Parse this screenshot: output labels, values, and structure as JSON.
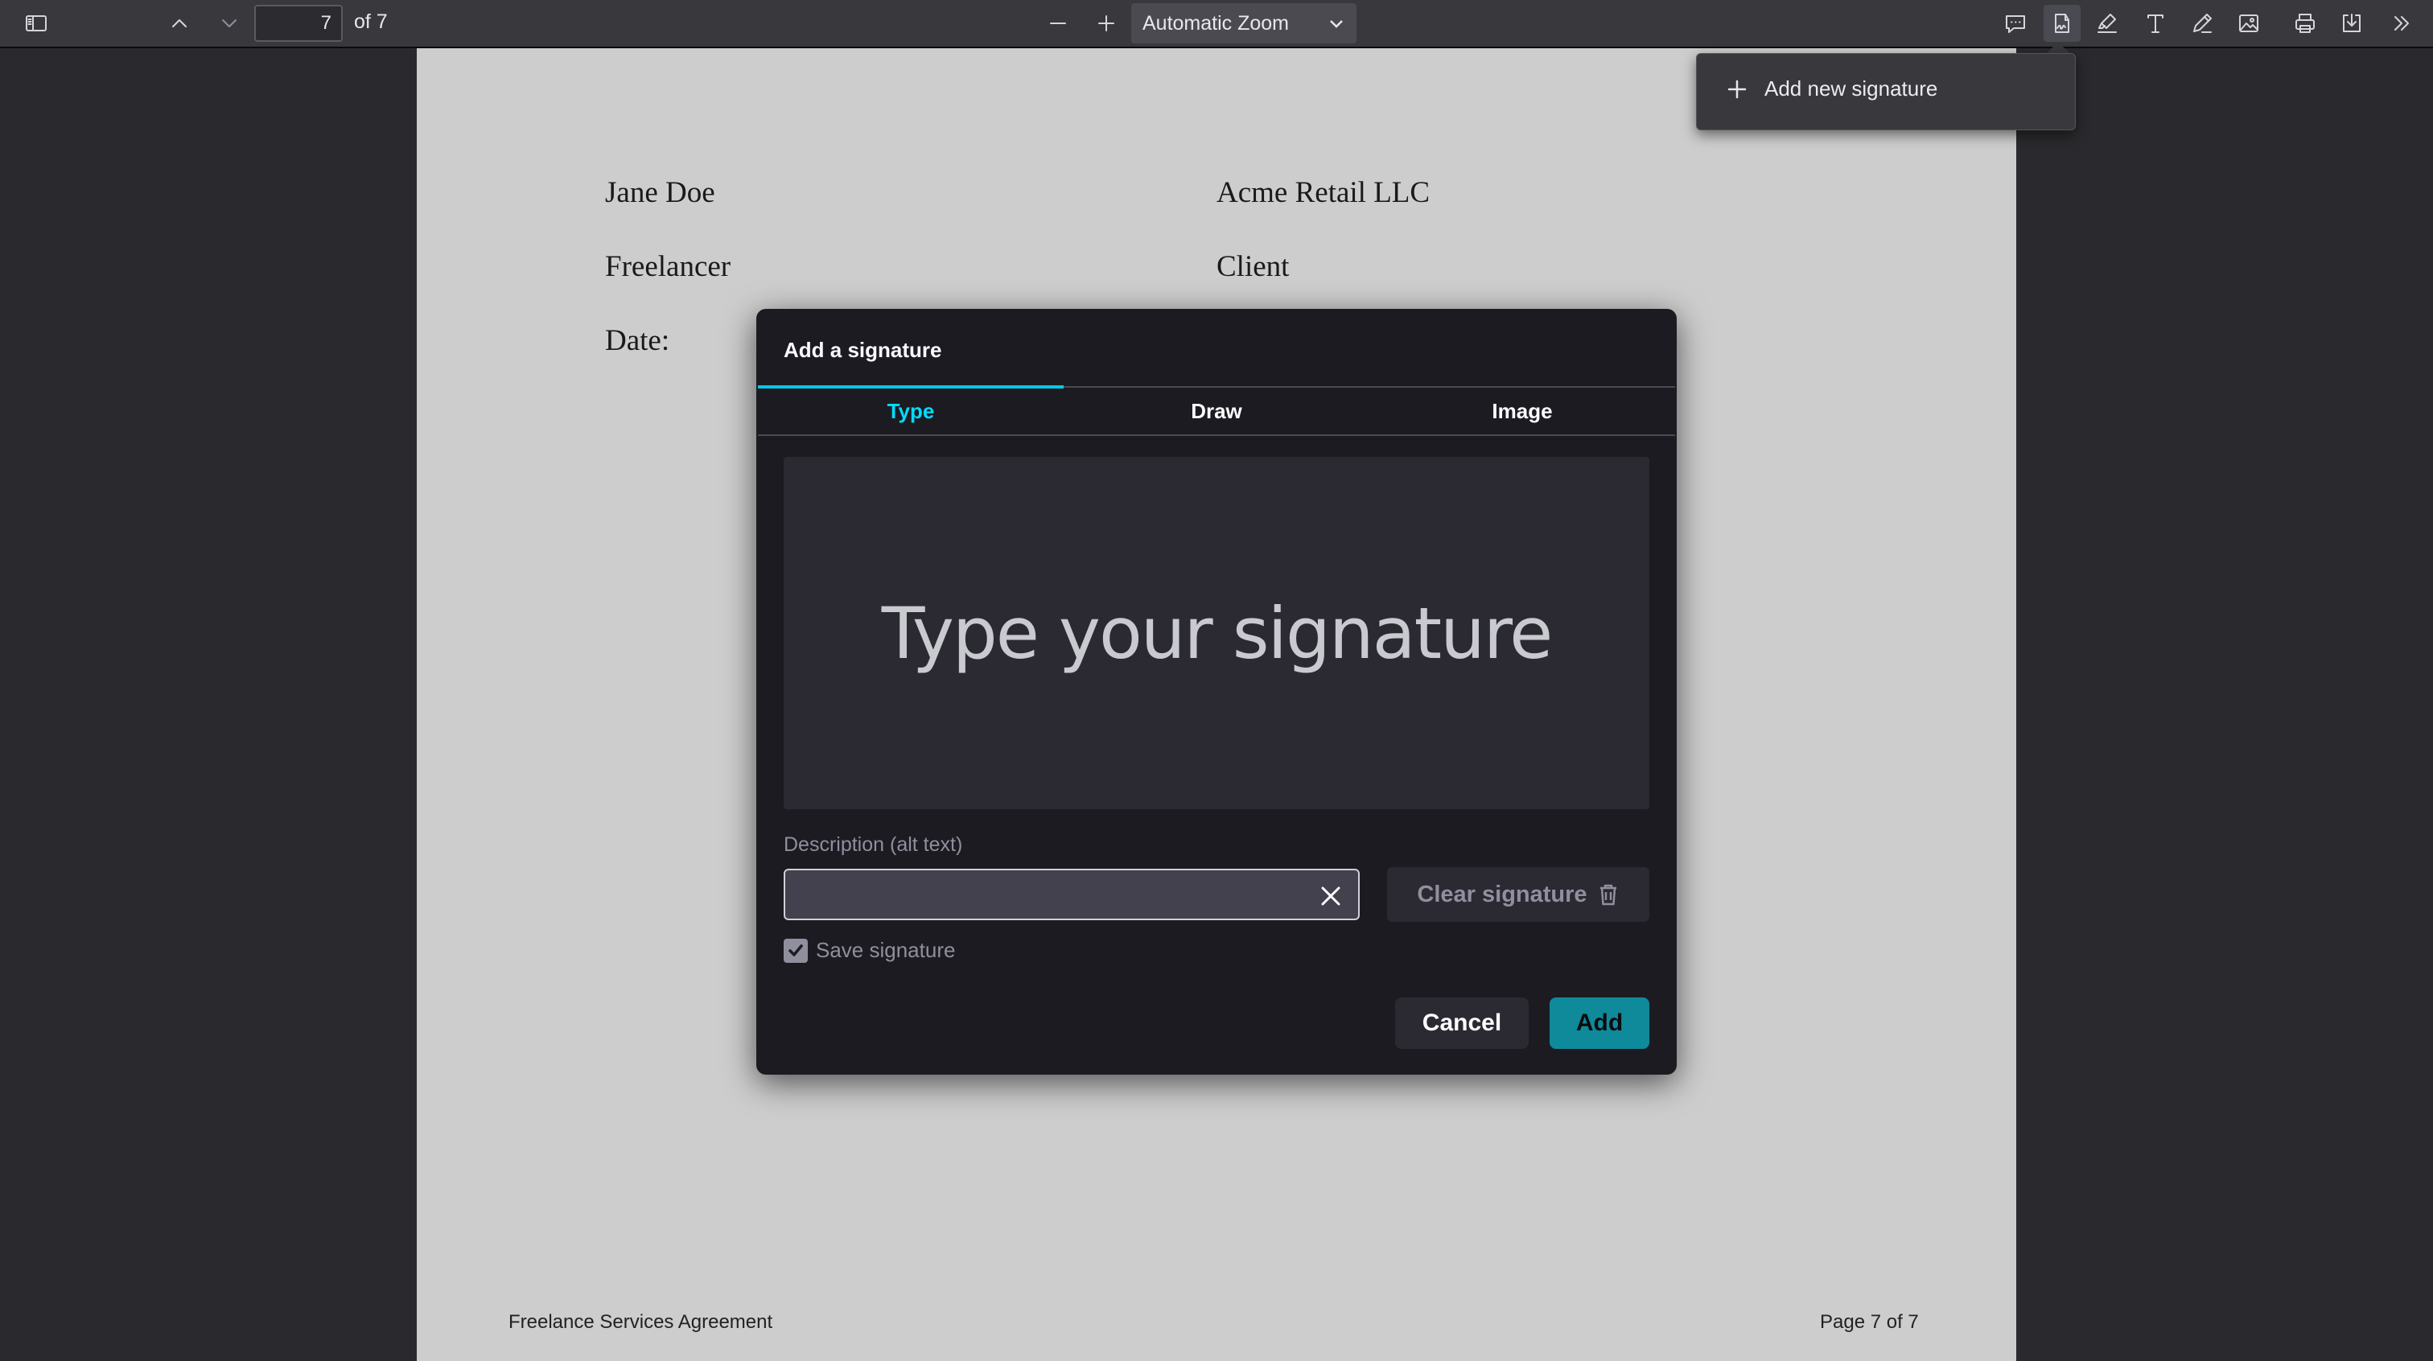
{
  "toolbar": {
    "page_number": "7",
    "page_count": "of 7",
    "zoom": "Automatic Zoom"
  },
  "document": {
    "left_name": "Jane Doe",
    "left_role": "Freelancer",
    "left_date": "Date:",
    "right_name": "Acme Retail LLC",
    "right_role": "Client",
    "footer_left": "Freelance Services Agreement",
    "footer_right": "Page 7 of 7"
  },
  "signature_menu": {
    "add_new": "Add new signature"
  },
  "dialog": {
    "title": "Add a signature",
    "tabs": [
      {
        "label": "Type",
        "selected": true
      },
      {
        "label": "Draw",
        "selected": false
      },
      {
        "label": "Image",
        "selected": false
      }
    ],
    "canvas_placeholder": "Type your signature",
    "description_label": "Description (alt text)",
    "description_value": "",
    "clear_signature": "Clear signature",
    "save_signature": "Save signature",
    "save_checked": true,
    "cancel": "Cancel",
    "add": "Add"
  },
  "colors": {
    "accent": "#00ddff",
    "add_button": "#0e8a9b",
    "dialog_bg": "#1c1b22"
  }
}
